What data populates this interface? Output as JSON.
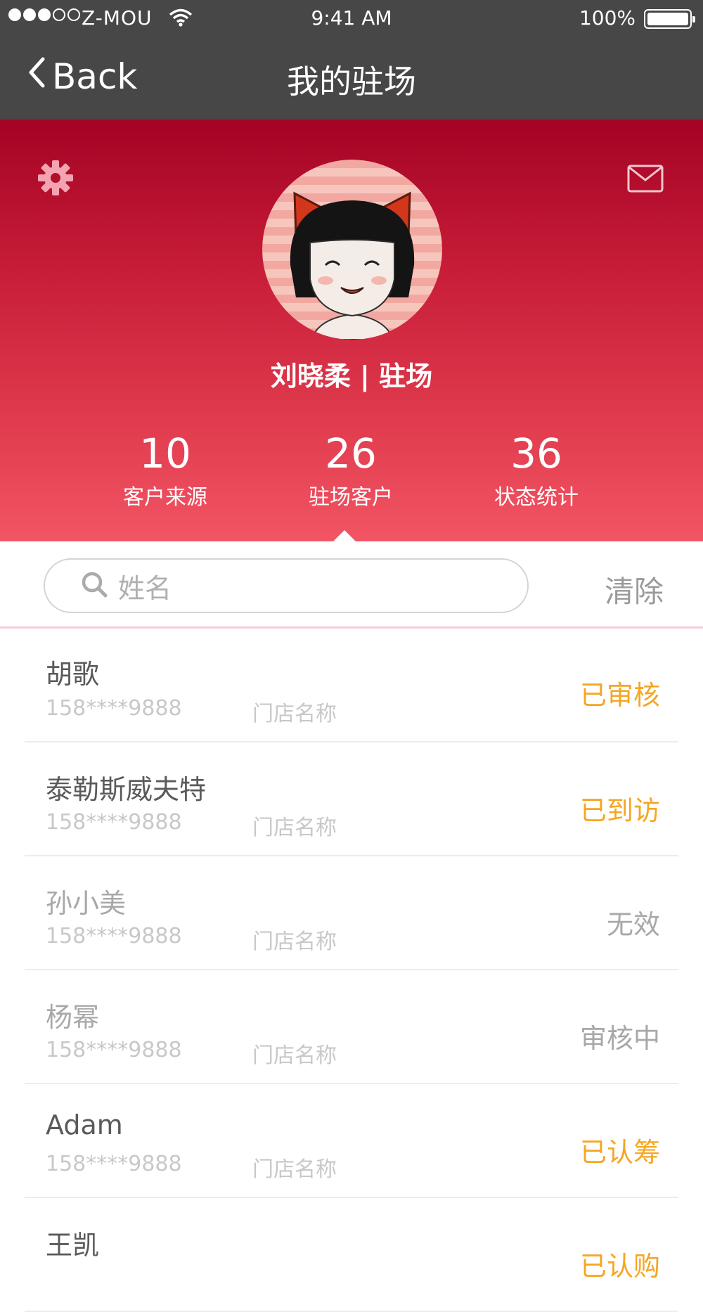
{
  "status_bar": {
    "carrier": "Z-MOU",
    "time": "9:41 AM",
    "battery": "100%"
  },
  "nav": {
    "back_label": "Back",
    "title": "我的驻场"
  },
  "profile": {
    "name_line": "刘晓柔 | 驻场"
  },
  "stats": [
    {
      "value": "10",
      "label": "客户来源"
    },
    {
      "value": "26",
      "label": "驻场客户"
    },
    {
      "value": "36",
      "label": "状态统计"
    }
  ],
  "search": {
    "placeholder": "姓名",
    "clear_label": "清除"
  },
  "customers": [
    {
      "name": "胡歌",
      "phone": "158****9888",
      "store": "门店名称",
      "status": "已审核",
      "status_color": "#f5a623",
      "name_color": "#5a5a5a"
    },
    {
      "name": "泰勒斯威夫特",
      "phone": "158****9888",
      "store": "门店名称",
      "status": "已到访",
      "status_color": "#f5a623",
      "name_color": "#5a5a5a"
    },
    {
      "name": "孙小美",
      "phone": "158****9888",
      "store": "门店名称",
      "status": "无效",
      "status_color": "#a8a8a8",
      "name_color": "#a8a8a8"
    },
    {
      "name": "杨幂",
      "phone": "158****9888",
      "store": "门店名称",
      "status": "审核中",
      "status_color": "#a8a8a8",
      "name_color": "#a8a8a8"
    },
    {
      "name": "Adam",
      "phone": "158****9888",
      "store": "门店名称",
      "status": "已认筹",
      "status_color": "#f5a623",
      "name_color": "#5a5a5a"
    },
    {
      "name": "王凯",
      "phone": "",
      "store": "",
      "status": "已认购",
      "status_color": "#f5a623",
      "name_color": "#5a5a5a"
    }
  ],
  "colors": {
    "nav_bg": "#474747",
    "header_top": "#a40324",
    "header_bottom": "#f25564",
    "accent_orange": "#f5a623"
  },
  "icons": [
    "signal-dots-icon",
    "wifi-icon",
    "battery-icon",
    "back-chevron-icon",
    "gear-icon",
    "mail-icon",
    "search-icon"
  ]
}
